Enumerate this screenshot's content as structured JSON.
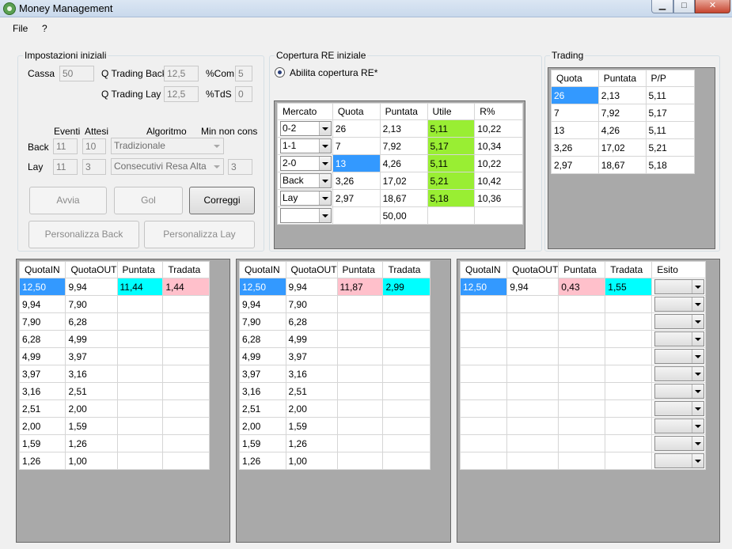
{
  "window": {
    "title": "Money Management",
    "min_glyph": "▁",
    "max_glyph": "□",
    "close_glyph": "✕"
  },
  "menu": [
    "File",
    "?"
  ],
  "impostazioni": {
    "legend": "Impostazioni iniziali",
    "cassa_label": "Cassa",
    "cassa_value": "50",
    "q_trading_back_label": "Q Trading Back",
    "q_trading_back_value": "12,5",
    "com_label": "%Com",
    "com_value": "5",
    "q_trading_lay_label": "Q Trading Lay",
    "q_trading_lay_value": "12,5",
    "tds_label": "%TdS",
    "tds_value": "0",
    "eventi_label": "Eventi",
    "attesi_label": "Attesi",
    "algoritmo_label": "Algoritmo",
    "min_non_cons_label": "Min non cons",
    "back_label": "Back",
    "back_eventi": "11",
    "back_attesi": "10",
    "back_algoritmo": "Tradizionale",
    "lay_label": "Lay",
    "lay_eventi": "11",
    "lay_attesi": "3",
    "lay_algoritmo": "Consecutivi Resa Alta",
    "lay_min_non_cons": "3",
    "avvia_label": "Avvia",
    "gol_label": "Gol",
    "correggi_label": "Correggi",
    "pers_back_label": "Personalizza Back",
    "pers_lay_label": "Personalizza Lay"
  },
  "copertura": {
    "legend": "Copertura RE iniziale",
    "radio_label": "Abilita copertura RE*",
    "headers": [
      "Mercato",
      "Quota",
      "Puntata",
      "Utile",
      "R%"
    ],
    "rows": [
      {
        "mercato": "0-2",
        "quota": "26",
        "puntata": "2,13",
        "utile": "5,11",
        "r": "10,22"
      },
      {
        "mercato": "1-1",
        "quota": "7",
        "puntata": "7,92",
        "utile": "5,17",
        "r": "10,34"
      },
      {
        "mercato": "2-0",
        "quota": "13",
        "puntata": "4,26",
        "utile": "5,11",
        "r": "10,22"
      },
      {
        "mercato": "Back",
        "quota": "3,26",
        "puntata": "17,02",
        "utile": "5,21",
        "r": "10,42"
      },
      {
        "mercato": "Lay",
        "quota": "2,97",
        "puntata": "18,67",
        "utile": "5,18",
        "r": "10,36"
      },
      {
        "mercato": "",
        "quota": "",
        "puntata": "50,00",
        "utile": "",
        "r": ""
      }
    ]
  },
  "trading": {
    "legend": "Trading",
    "headers": [
      "Quota",
      "Puntata",
      "P/P"
    ],
    "rows": [
      [
        "26",
        "2,13",
        "5,11"
      ],
      [
        "7",
        "7,92",
        "5,17"
      ],
      [
        "13",
        "4,26",
        "5,11"
      ],
      [
        "3,26",
        "17,02",
        "5,21"
      ],
      [
        "2,97",
        "18,67",
        "5,18"
      ]
    ]
  },
  "grid1": {
    "headers": [
      "QuotaIN",
      "QuotaOUT",
      "Puntata",
      "Tradata"
    ],
    "rows": [
      [
        "12,50",
        "9,94",
        "11,44",
        "1,44"
      ],
      [
        "9,94",
        "7,90",
        "",
        ""
      ],
      [
        "7,90",
        "6,28",
        "",
        ""
      ],
      [
        "6,28",
        "4,99",
        "",
        ""
      ],
      [
        "4,99",
        "3,97",
        "",
        ""
      ],
      [
        "3,97",
        "3,16",
        "",
        ""
      ],
      [
        "3,16",
        "2,51",
        "",
        ""
      ],
      [
        "2,51",
        "2,00",
        "",
        ""
      ],
      [
        "2,00",
        "1,59",
        "",
        ""
      ],
      [
        "1,59",
        "1,26",
        "",
        ""
      ],
      [
        "1,26",
        "1,00",
        "",
        ""
      ]
    ]
  },
  "grid2": {
    "headers": [
      "QuotaIN",
      "QuotaOUT",
      "Puntata",
      "Tradata"
    ],
    "rows": [
      [
        "12,50",
        "9,94",
        "11,87",
        "2,99"
      ],
      [
        "9,94",
        "7,90",
        "",
        ""
      ],
      [
        "7,90",
        "6,28",
        "",
        ""
      ],
      [
        "6,28",
        "4,99",
        "",
        ""
      ],
      [
        "4,99",
        "3,97",
        "",
        ""
      ],
      [
        "3,97",
        "3,16",
        "",
        ""
      ],
      [
        "3,16",
        "2,51",
        "",
        ""
      ],
      [
        "2,51",
        "2,00",
        "",
        ""
      ],
      [
        "2,00",
        "1,59",
        "",
        ""
      ],
      [
        "1,59",
        "1,26",
        "",
        ""
      ],
      [
        "1,26",
        "1,00",
        "",
        ""
      ]
    ]
  },
  "grid3": {
    "headers": [
      "QuotaIN",
      "QuotaOUT",
      "Puntata",
      "Tradata",
      "Esito"
    ],
    "rows": [
      [
        "12,50",
        "9,94",
        "0,43",
        "1,55"
      ],
      [
        "",
        "",
        "",
        ""
      ],
      [
        "",
        "",
        "",
        ""
      ],
      [
        "",
        "",
        "",
        ""
      ],
      [
        "",
        "",
        "",
        ""
      ],
      [
        "",
        "",
        "",
        ""
      ],
      [
        "",
        "",
        "",
        ""
      ],
      [
        "",
        "",
        "",
        ""
      ],
      [
        "",
        "",
        "",
        ""
      ],
      [
        "",
        "",
        "",
        ""
      ],
      [
        "",
        "",
        "",
        ""
      ]
    ]
  },
  "colors": {
    "selection": "#3399ff",
    "utile_green": "#99ee33",
    "cyan": "#00ffff",
    "pink": "#ffc0cb",
    "grid_bg": "#a9a9a9"
  }
}
